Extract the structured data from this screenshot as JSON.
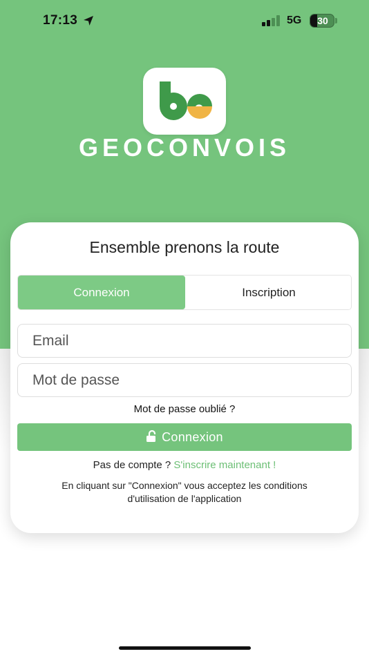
{
  "status_bar": {
    "time": "17:13",
    "network": "5G",
    "battery": "30",
    "battery_level_percent": 30
  },
  "icons": {
    "location": "location-arrow-icon",
    "signal": "cellular-signal-icon",
    "battery": "battery-icon",
    "lock": "unlock-icon"
  },
  "brand": {
    "name": "GEOCONVOIS"
  },
  "colors": {
    "brand_green": "#75c47d",
    "brand_dark_green": "#3f9a4a",
    "brand_yellow": "#f0b445"
  },
  "card": {
    "title": "Ensemble prenons la route",
    "tabs": [
      {
        "label": "Connexion",
        "active": true
      },
      {
        "label": "Inscription",
        "active": false
      }
    ],
    "email_placeholder": "Email",
    "password_placeholder": "Mot de passe",
    "forgot_password": "Mot de passe oublié ?",
    "login_button": "Connexion",
    "no_account": "Pas de compte ?",
    "signup_link": "S'inscrire maintenant !",
    "terms_line1": "En cliquant sur \"Connexion\" vous acceptez les conditions",
    "terms_line2": "d'utilisation de l'application"
  }
}
